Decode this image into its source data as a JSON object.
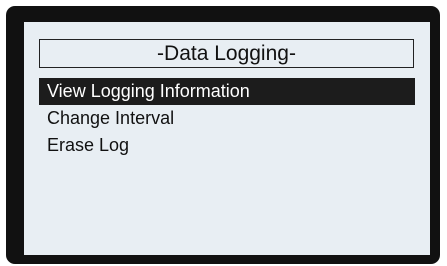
{
  "screen": {
    "title": "-Data Logging-",
    "menu": {
      "selected_index": 0,
      "items": [
        {
          "label": "View Logging Information"
        },
        {
          "label": "Change Interval"
        },
        {
          "label": "Erase Log"
        }
      ]
    }
  },
  "colors": {
    "bezel": "#111111",
    "screen_background": "#e8eef3",
    "selection_background": "#1c1c1c",
    "selection_text": "#ffffff",
    "text": "#111111"
  }
}
